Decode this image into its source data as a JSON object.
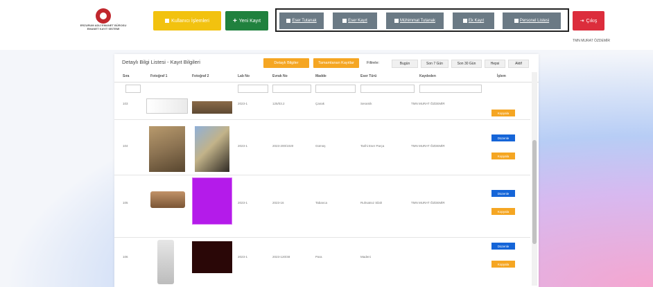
{
  "header": {
    "logo_lines": [
      "ERZURUM ADLİ EMANET BÜROSU",
      "EMANET KAYIT SİSTEMİ"
    ],
    "user_name": "TMN MURAT ÖZDEMİR",
    "buttons": {
      "primary": "Kullanıcı İşlemleri",
      "new": "Yeni Kayıt",
      "logout": "Çıkış"
    },
    "modules": [
      "Eser Tutanak",
      "Eser Kayıt",
      "Mühimmat Tutanak",
      "Ek Kayıt",
      "Personel Listesi"
    ]
  },
  "panel": {
    "title": "Detaylı Bilgi Listesi - Kayıt Bilgileri",
    "actions": [
      "Detaylı Bilgiler",
      "Tamamlanan Kayıtlar"
    ],
    "filter_label": "Filtrele:",
    "filters": [
      "Bugün",
      "Son 7 Gün",
      "Son 30 Gün",
      "Hepsi",
      "Aktif"
    ]
  },
  "table": {
    "columns": [
      "Sıra",
      "Fotoğraf 1",
      "Fotoğraf 2",
      "Lab No",
      "Evrak No",
      "Madde",
      "Eser Türü",
      "Kaydeden",
      "İşlem"
    ],
    "rows": [
      {
        "no": "103",
        "lab": "2023-1",
        "evrak": "125/03.2",
        "madde": "Çanak",
        "tur": "Seramik",
        "kaydeden": "TMN MURAT ÖZDEMİR",
        "edit": "",
        "dup": "Kopyala"
      },
      {
        "no": "104",
        "lab": "2023-1",
        "evrak": "2023-200/1020",
        "madde": "Gümüş",
        "tur": "Tarihi Eser Parça",
        "kaydeden": "TMN MURAT ÖZDEMİR",
        "edit": "Düzenle",
        "dup": "Kopyala"
      },
      {
        "no": "105",
        "lab": "2023-1",
        "evrak": "2023-16",
        "madde": "Tabanca",
        "tur": "Ruhsatsız Silah",
        "kaydeden": "TMN MURAT ÖZDEMİR",
        "edit": "Düzenle",
        "dup": "Kopyala"
      },
      {
        "no": "106",
        "lab": "2023-1",
        "evrak": "2023-120/48",
        "madde": "Para",
        "tur": "Madeni",
        "kaydeden": "",
        "edit": "Düzenle",
        "dup": "Kopyala"
      }
    ]
  },
  "colors": {
    "yellow": "#f2c20f",
    "green": "#20813e",
    "red": "#dc2d3c",
    "module_gray": "#6b7a85",
    "orange": "#f5a623",
    "blue": "#1565d8"
  }
}
